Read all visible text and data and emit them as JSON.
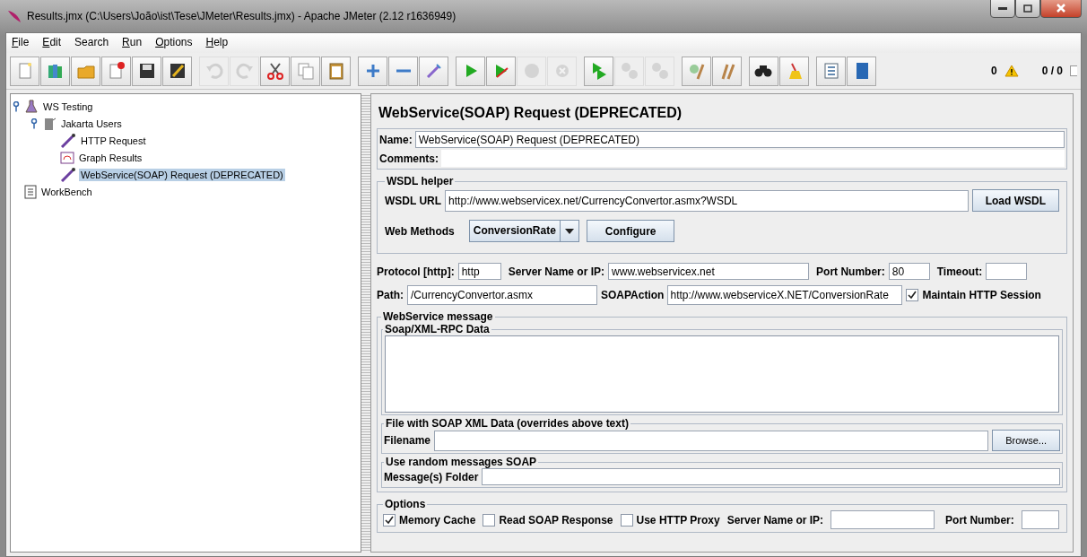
{
  "window": {
    "title": "Results.jmx (C:\\Users\\João\\ist\\Tese\\JMeter\\Results.jmx) - Apache JMeter (2.12 r1636949)"
  },
  "menu": [
    {
      "label": "File",
      "mnemonic": true
    },
    {
      "label": "Edit",
      "mnemonic": true
    },
    {
      "label": "Search",
      "mnemonic": false
    },
    {
      "label": "Run",
      "mnemonic": true
    },
    {
      "label": "Options",
      "mnemonic": true
    },
    {
      "label": "Help",
      "mnemonic": true
    }
  ],
  "toolbar": {
    "groups": [
      [
        {
          "disabled": false
        },
        {
          "disabled": false
        },
        {
          "disabled": false
        },
        {
          "disabled": false
        },
        {
          "disabled": false
        },
        {
          "disabled": false
        }
      ],
      [
        {
          "disabled": true
        },
        {
          "disabled": true
        },
        {
          "disabled": false
        },
        {
          "disabled": false
        },
        {
          "disabled": false
        }
      ],
      [
        {
          "disabled": false
        },
        {
          "disabled": false
        },
        {
          "disabled": false
        }
      ],
      [
        {
          "disabled": false
        },
        {
          "disabled": false
        },
        {
          "disabled": true
        },
        {
          "disabled": true
        }
      ],
      [
        {
          "disabled": false
        },
        {
          "disabled": true
        },
        {
          "disabled": true
        }
      ],
      [
        {
          "disabled": false
        },
        {
          "disabled": false
        }
      ],
      [
        {
          "disabled": false
        },
        {
          "disabled": false
        }
      ],
      [
        {
          "disabled": false
        },
        {
          "disabled": false
        }
      ]
    ],
    "error_count": "0",
    "thread_count": "0 / 0"
  },
  "tree": [
    {
      "label": "WS Testing",
      "kind": "test-plan",
      "expanded": true,
      "selected": false,
      "children": [
        {
          "label": "Jakarta Users",
          "kind": "thread-group",
          "expanded": true,
          "selected": false,
          "children": [
            {
              "label": "HTTP Request",
              "kind": "sampler",
              "selected": false
            },
            {
              "label": "Graph Results",
              "kind": "listener",
              "selected": false
            },
            {
              "label": "WebService(SOAP) Request (DEPRECATED)",
              "kind": "sampler",
              "selected": true
            }
          ]
        }
      ]
    },
    {
      "label": "WorkBench",
      "kind": "workbench",
      "selected": false
    }
  ],
  "panel": {
    "title": "WebService(SOAP) Request (DEPRECATED)",
    "name": {
      "label": "Name:",
      "value": "WebService(SOAP) Request (DEPRECATED)"
    },
    "comments": {
      "label": "Comments:"
    },
    "wsdl_helper": {
      "legend": "WSDL helper",
      "url_label": "WSDL URL",
      "url": "http://www.webservicex.net/CurrencyConvertor.asmx?WSDL",
      "load_button": "Load WSDL",
      "methods_label": "Web Methods",
      "method": "ConversionRate",
      "configure_button": "Configure"
    },
    "protocol": {
      "label": "Protocol [http]:",
      "value": "http"
    },
    "server": {
      "label": "Server Name or IP:",
      "value": "www.webservicex.net"
    },
    "port": {
      "label": "Port Number:",
      "value": "80"
    },
    "timeout": {
      "label": "Timeout:"
    },
    "path": {
      "label": "Path:",
      "value": "/CurrencyConvertor.asmx"
    },
    "soap_action": {
      "label": "SOAPAction",
      "value": "http://www.webserviceX.NET/ConversionRate"
    },
    "maintain_session": {
      "label": "Maintain HTTP Session",
      "checked": true
    },
    "message": {
      "legend": "WebService message",
      "data_legend": "Soap/XML-RPC Data",
      "file_legend": "File with SOAP XML Data (overrides above text)",
      "filename_label": "Filename",
      "browse_button": "Browse...",
      "random_legend": "Use random messages SOAP",
      "folder_label": "Message(s) Folder"
    },
    "options": {
      "legend": "Options",
      "checks": [
        {
          "label": "Memory Cache",
          "checked": true
        },
        {
          "label": "Read SOAP Response",
          "checked": false
        },
        {
          "label": "Use HTTP Proxy",
          "checked": false
        }
      ],
      "proxy_server_label": "Server Name or IP:",
      "proxy_port_label": "Port Number:"
    }
  }
}
